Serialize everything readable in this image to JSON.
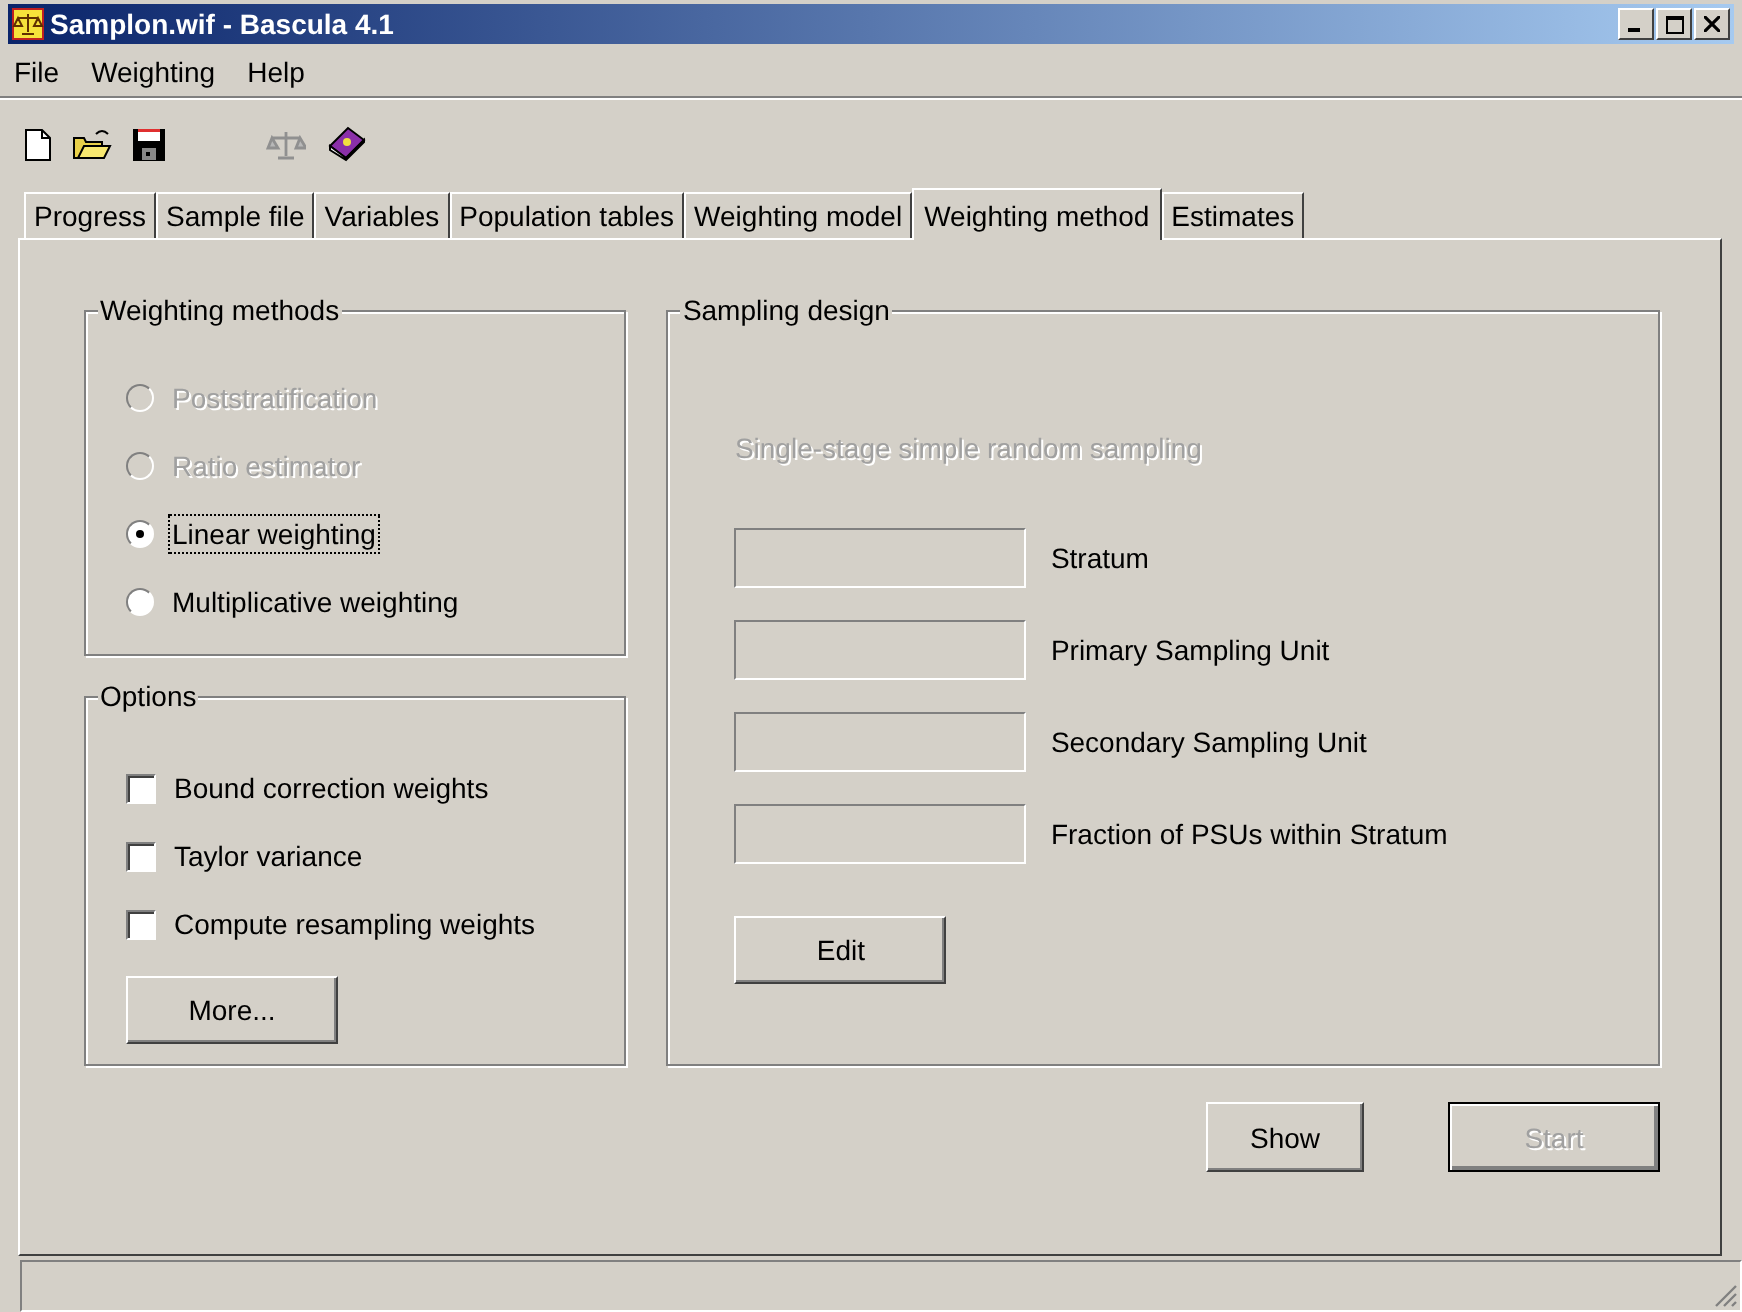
{
  "window": {
    "title": "Samplon.wif - Bascula 4.1"
  },
  "menu": [
    "File",
    "Weighting",
    "Help"
  ],
  "tabs": [
    {
      "label": "Progress",
      "selected": false
    },
    {
      "label": "Sample file",
      "selected": false
    },
    {
      "label": "Variables",
      "selected": false
    },
    {
      "label": "Population tables",
      "selected": false
    },
    {
      "label": "Weighting model",
      "selected": false
    },
    {
      "label": "Weighting method",
      "selected": true
    },
    {
      "label": "Estimates",
      "selected": false
    }
  ],
  "weighting_methods": {
    "title": "Weighting methods",
    "options": [
      {
        "label": "Poststratification",
        "selected": false,
        "disabled": true
      },
      {
        "label": "Ratio estimator",
        "selected": false,
        "disabled": true
      },
      {
        "label": "Linear weighting",
        "selected": true,
        "disabled": false
      },
      {
        "label": "Multiplicative weighting",
        "selected": false,
        "disabled": false
      }
    ]
  },
  "options": {
    "title": "Options",
    "items": [
      {
        "label": "Bound correction weights",
        "checked": false
      },
      {
        "label": "Taylor variance",
        "checked": false
      },
      {
        "label": "Compute resampling weights",
        "checked": false
      }
    ],
    "button": "More..."
  },
  "sampling_design": {
    "title": "Sampling design",
    "description": "Single-stage simple random sampling",
    "description_disabled": true,
    "fields": [
      {
        "label": "Stratum"
      },
      {
        "label": "Primary Sampling Unit"
      },
      {
        "label": "Secondary Sampling Unit"
      },
      {
        "label": "Fraction of PSUs within Stratum"
      }
    ],
    "button": "Edit"
  },
  "buttons": [
    {
      "label": "Show",
      "disabled": false
    },
    {
      "label": "Start",
      "disabled": true
    }
  ]
}
